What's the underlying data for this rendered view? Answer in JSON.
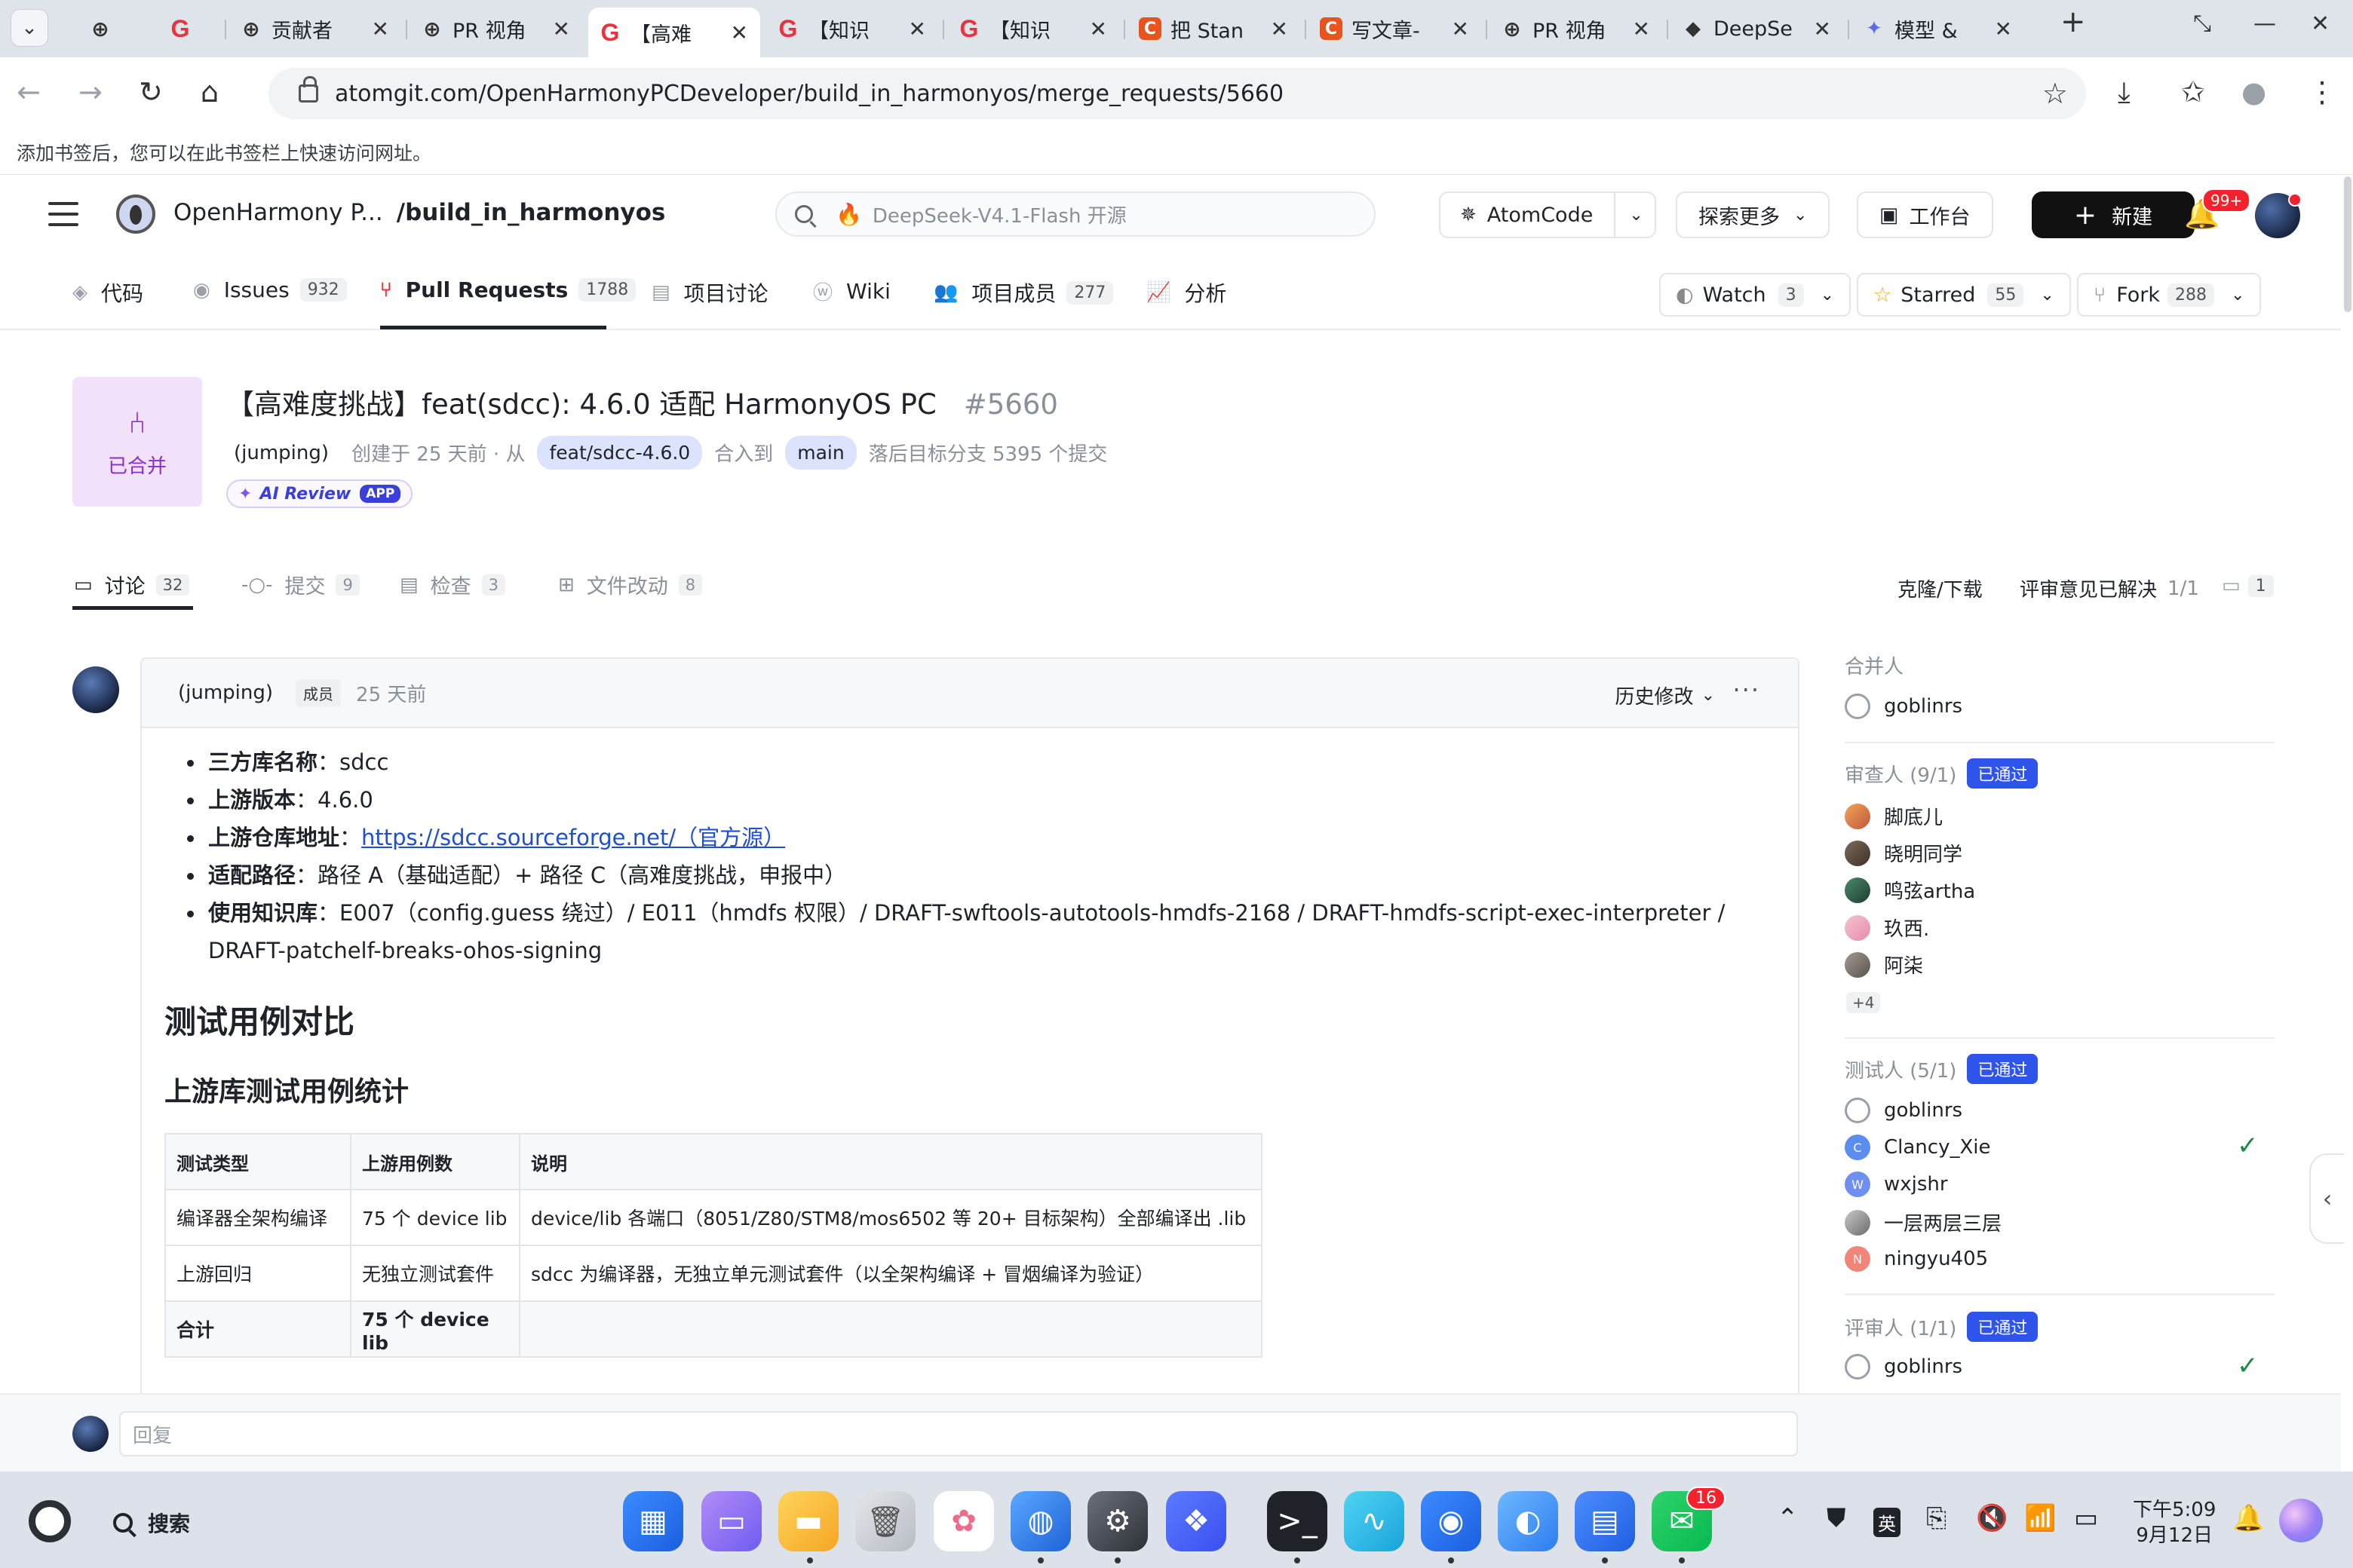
{
  "browser": {
    "tabs": [
      {
        "icon": "globe",
        "title": ""
      },
      {
        "icon": "g",
        "title": ""
      },
      {
        "icon": "globe",
        "title": "贡献者"
      },
      {
        "icon": "globe",
        "title": "PR 视角"
      },
      {
        "icon": "g",
        "title": "【高难"
      },
      {
        "icon": "g",
        "title": "【知识"
      },
      {
        "icon": "g",
        "title": "【知识"
      },
      {
        "icon": "c",
        "title": "把 Stan"
      },
      {
        "icon": "c",
        "title": "写文章-"
      },
      {
        "icon": "globe",
        "title": "PR 视角"
      },
      {
        "icon": "whale",
        "title": "DeepSe"
      },
      {
        "icon": "gem",
        "title": "模型 &"
      }
    ],
    "active_tab_index": 4,
    "url": "atomgit.com/OpenHarmonyPCDeveloper/build_in_harmonyos/merge_requests/5660",
    "bookmark_hint": "添加书签后，您可以在此书签栏上快速访问网址。"
  },
  "site": {
    "repo_owner": "OpenHarmony P...",
    "repo_name": "/build_in_harmonyos",
    "search_placeholder": "DeepSeek-V4.1-Flash 开源",
    "atomcode": "AtomCode",
    "explore": "探索更多",
    "workbench": "工作台",
    "new_button": "新建",
    "notifications": "99+"
  },
  "repo_nav": {
    "tabs": [
      {
        "label": "代码",
        "count": ""
      },
      {
        "label": "Issues",
        "count": "932"
      },
      {
        "label": "Pull Requests",
        "count": "1788"
      },
      {
        "label": "项目讨论",
        "count": ""
      },
      {
        "label": "Wiki",
        "count": ""
      },
      {
        "label": "项目成员",
        "count": "277"
      },
      {
        "label": "分析",
        "count": ""
      }
    ],
    "watch": {
      "label": "Watch",
      "count": "3"
    },
    "starred": {
      "label": "Starred",
      "count": "55"
    },
    "fork": {
      "label": "Fork",
      "count": "288"
    }
  },
  "mr": {
    "status": "已合并",
    "title": "【高难度挑战】feat(sdcc): 4.6.0 适配 HarmonyOS PC",
    "number": "#5660",
    "author": "(jumping)",
    "created": "创建于 25 天前 · 从",
    "source_branch": "feat/sdcc-4.6.0",
    "merge_into": "合入到",
    "target_branch": "main",
    "behind": "落后目标分支 5395 个提交",
    "ai_review": "AI Review",
    "ai_review_badge": "APP"
  },
  "subtabs": [
    {
      "label": "讨论",
      "count": "32"
    },
    {
      "label": "提交",
      "count": "9"
    },
    {
      "label": "检查",
      "count": "3"
    },
    {
      "label": "文件改动",
      "count": "8"
    }
  ],
  "subtabs_right": {
    "clone": "克隆/下载",
    "resolved_label": "评审意见已解决",
    "resolved_value": "1/1",
    "comments": "1"
  },
  "comment": {
    "author": "(jumping)",
    "role": "成员",
    "time": "25 天前",
    "history": "历史修改",
    "items": [
      {
        "key": "三方库名称",
        "sep": "：",
        "value": "sdcc",
        "link": ""
      },
      {
        "key": "上游版本",
        "sep": "：",
        "value": "4.6.0",
        "link": ""
      },
      {
        "key": "上游仓库地址",
        "sep": "：",
        "value": "",
        "link": "https://sdcc.sourceforge.net/（官方源）"
      },
      {
        "key": "适配路径",
        "sep": "：",
        "value": "路径 A（基础适配）+ 路径 C（高难度挑战，申报中）",
        "link": ""
      },
      {
        "key": "使用知识库",
        "sep": "：",
        "value": "E007（config.guess 绕过）/ E011（hmdfs 权限）/ DRAFT-swftools-autotools-hmdfs-2168 / DRAFT-hmdfs-script-exec-interpreter / DRAFT-patchelf-breaks-ohos-signing",
        "link": ""
      }
    ],
    "h2": "测试用例对比",
    "h3": "上游库测试用例统计",
    "table": {
      "headers": [
        "测试类型",
        "上游用例数",
        "说明"
      ],
      "rows": [
        [
          "编译器全架构编译",
          "75 个 device lib",
          "device/lib 各端口（8051/Z80/STM8/mos6502 等 20+ 目标架构）全部编译出 .lib"
        ],
        [
          "上游回归",
          "无独立测试套件",
          "sdcc 为编译器，无独立单元测试套件（以全架构编译 + 冒烟编译为验证）"
        ],
        [
          "合计",
          "75 个 device lib",
          ""
        ]
      ]
    },
    "reply_placeholder": "回复"
  },
  "sidebar": {
    "merger_title": "合并人",
    "merger": [
      "goblinrs"
    ],
    "reviewers_title": "审查人 (9/1)",
    "reviewers_status": "已通过",
    "reviewers": [
      "脚底儿",
      "晓明同学",
      "鸣弦artha",
      "玖西.",
      "阿柒"
    ],
    "reviewers_more": "+4",
    "testers_title": "测试人 (5/1)",
    "testers_status": "已通过",
    "testers": [
      "goblinrs",
      "Clancy_Xie",
      "wxjshr",
      "一层两层三层",
      "ningyu405"
    ],
    "approvers_title": "评审人 (1/1)",
    "approvers_status": "已通过",
    "approvers": [
      "goblinrs"
    ]
  },
  "taskbar": {
    "search": "搜索",
    "wechat_badge": "16",
    "ime": "英",
    "time": "下午5:09",
    "date": "9月12日"
  }
}
